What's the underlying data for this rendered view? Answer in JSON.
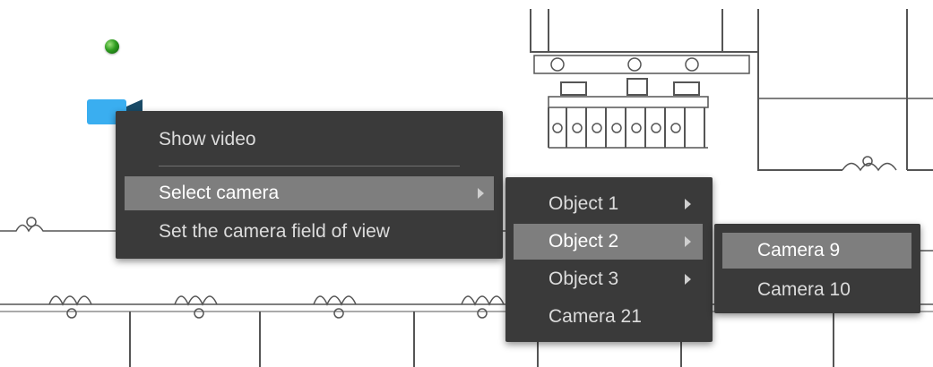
{
  "map": {
    "marker": {
      "icon": "green-dot-icon",
      "color": "#2e9c1f"
    },
    "camera": {
      "icon": "video-camera-icon",
      "color": "#3aaef0"
    }
  },
  "context_menu": {
    "items": [
      {
        "label": "Show video"
      },
      {
        "label": "Select camera",
        "has_submenu": true,
        "selected": true
      },
      {
        "label": "Set the camera field of view"
      }
    ]
  },
  "objects_submenu": {
    "items": [
      {
        "label": "Object 1",
        "has_submenu": true
      },
      {
        "label": "Object 2",
        "has_submenu": true,
        "selected": true
      },
      {
        "label": "Object 3",
        "has_submenu": true
      },
      {
        "label": "Camera 21"
      }
    ]
  },
  "cameras_submenu": {
    "items": [
      {
        "label": "Camera 9",
        "selected": true
      },
      {
        "label": "Camera 10"
      }
    ]
  },
  "colors": {
    "menu_background": "#3a3a3a",
    "menu_highlight": "#7e7e7e",
    "menu_text": "#dcdcdc"
  }
}
